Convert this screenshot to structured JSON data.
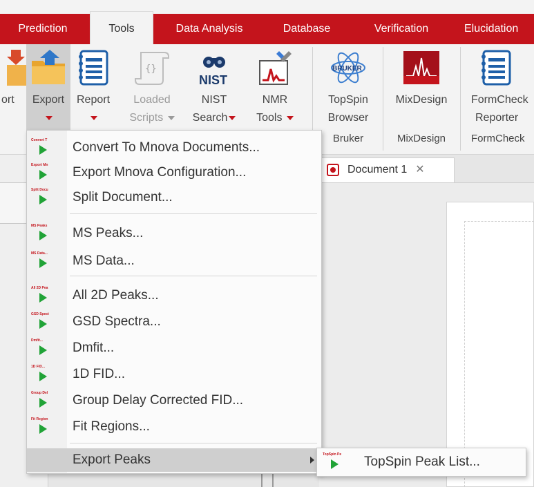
{
  "menubar": {
    "tabs": [
      "Prediction",
      "Tools",
      "Data Analysis",
      "Database",
      "Verification",
      "Elucidation"
    ],
    "active_tab": "Tools"
  },
  "ribbon": {
    "buttons": [
      {
        "label1": "ort",
        "label2": ""
      },
      {
        "label1": "Export",
        "label2": ""
      },
      {
        "label1": "Report",
        "label2": ""
      },
      {
        "label1": "Loaded",
        "label2": "Scripts"
      },
      {
        "label1": "NIST",
        "label2": "Search"
      },
      {
        "label1": "NMR",
        "label2": "Tools"
      },
      {
        "label1": "TopSpin",
        "label2": "Browser"
      },
      {
        "label1": "MixDesign",
        "label2": ""
      },
      {
        "label1": "FormCheck",
        "label2": "Reporter"
      }
    ],
    "groups": [
      "Bruker",
      "MixDesign",
      "FormCheck"
    ],
    "nist_logo": "NIST",
    "bruker_logo": "BRUKER"
  },
  "document_tab": {
    "label": "Document 1",
    "close": "✕"
  },
  "export_menu": {
    "items": [
      {
        "label": "Convert To Mnova Documents...",
        "tag": "Convert T"
      },
      {
        "label": "Export Mnova Configuration...",
        "tag": "Export Mn"
      },
      {
        "label": "Split Document...",
        "tag": "Split Docu"
      },
      {
        "label": "MS Peaks...",
        "tag": "MS Peaks"
      },
      {
        "label": "MS Data...",
        "tag": "MS Data..."
      },
      {
        "label": "All 2D Peaks...",
        "tag": "All 2D Pea"
      },
      {
        "label": "GSD Spectra...",
        "tag": "GSD Spect"
      },
      {
        "label": "Dmfit...",
        "tag": "Dmfit..."
      },
      {
        "label": "1D FID...",
        "tag": "1D FID..."
      },
      {
        "label": "Group Delay Corrected FID...",
        "tag": "Group Del"
      },
      {
        "label": "Fit Regions...",
        "tag": "Fit Region"
      },
      {
        "label": "Export Peaks",
        "tag": ""
      }
    ]
  },
  "submenu": {
    "items": [
      {
        "label": "TopSpin Peak List...",
        "tag": "TopSpin Pe"
      }
    ]
  },
  "colors": {
    "accent": "#c4141c",
    "play": "#21a337",
    "highlight": "#cfcfcf"
  }
}
